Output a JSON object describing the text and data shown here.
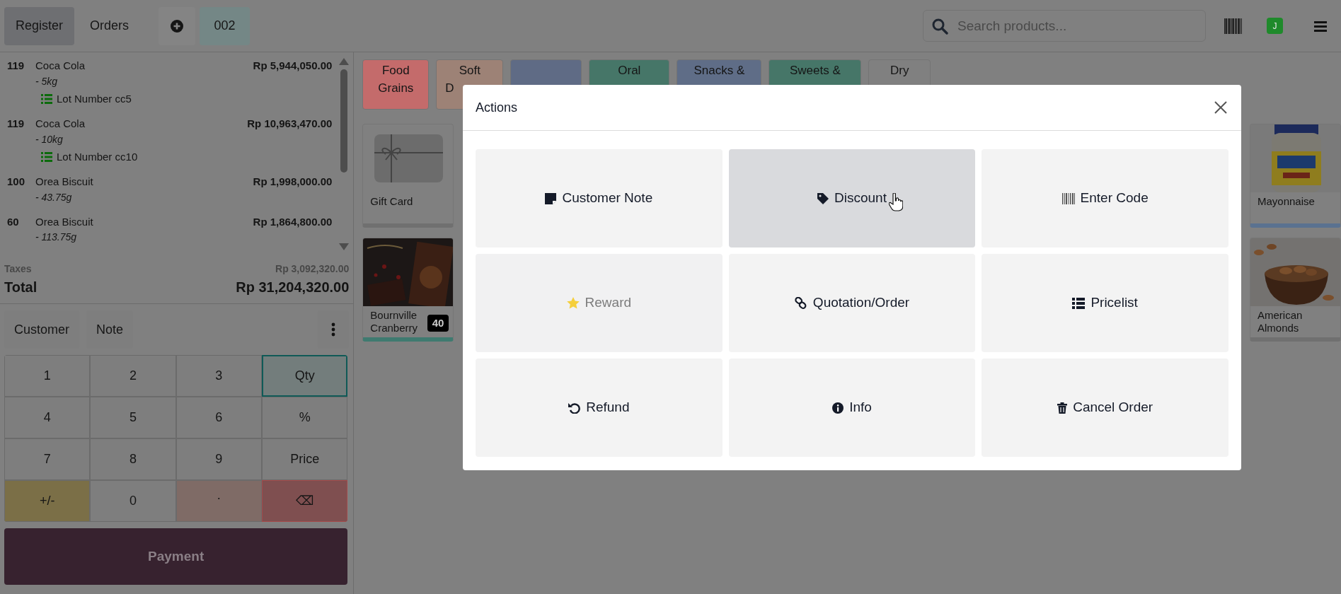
{
  "topbar": {
    "tabs": [
      {
        "label": "Register",
        "selected": true
      },
      {
        "label": "Orders",
        "selected": false
      }
    ],
    "order_tabs": [
      {
        "label": "002",
        "selected": true
      }
    ],
    "search": {
      "placeholder": "Search products..."
    },
    "user_initial": "J"
  },
  "order_lines": [
    {
      "qty": "119",
      "product": "Coca Cola",
      "variant": "- 5kg",
      "lot": "Lot Number cc5",
      "price": "Rp 5,944,050.00"
    },
    {
      "qty": "119",
      "product": "Coca Cola",
      "variant": "- 10kg",
      "lot": "Lot Number cc10",
      "price": "Rp 10,963,470.00"
    },
    {
      "qty": "100",
      "product": "Orea Biscuit",
      "variant": "- 43.75g",
      "price": "Rp 1,998,000.00"
    },
    {
      "qty": "60",
      "product": "Orea Biscuit",
      "variant": "- 113.75g",
      "price": "Rp 1,864,800.00"
    }
  ],
  "taxes": {
    "label": "Taxes",
    "amount": "Rp 3,092,320.00"
  },
  "total": {
    "label": "Total",
    "amount": "Rp 31,204,320.00"
  },
  "control_buttons": [
    "Customer",
    "Note"
  ],
  "numpad": [
    {
      "label": "1",
      "kind": "key"
    },
    {
      "label": "2",
      "kind": "key"
    },
    {
      "label": "3",
      "kind": "key"
    },
    {
      "label": "Qty",
      "kind": "mode",
      "selected": true
    },
    {
      "label": "4",
      "kind": "key"
    },
    {
      "label": "5",
      "kind": "key"
    },
    {
      "label": "6",
      "kind": "key"
    },
    {
      "label": "%",
      "kind": "mode",
      "selected": false
    },
    {
      "label": "7",
      "kind": "key"
    },
    {
      "label": "8",
      "kind": "key"
    },
    {
      "label": "9",
      "kind": "key"
    },
    {
      "label": "Price",
      "kind": "mode",
      "selected": false
    },
    {
      "label": "+/-",
      "kind": "sign"
    },
    {
      "label": "0",
      "kind": "key"
    },
    {
      "label": ".",
      "kind": "decimal"
    },
    {
      "label": "⌫",
      "kind": "backspace"
    }
  ],
  "payment_button": "Payment",
  "categories": [
    {
      "lines": [
        "Food",
        "Grains"
      ],
      "color": "#c46b6b"
    },
    {
      "lines": [
        "Soft",
        "D"
      ],
      "color": "#9d8276"
    },
    {
      "color": "#5f6b85"
    },
    {
      "lines": [
        "Oral"
      ],
      "color": "#467668"
    },
    {
      "lines": [
        "Snacks &"
      ],
      "color": "#5f6d87"
    },
    {
      "lines": [
        "Sweets &"
      ],
      "color": "#467668"
    },
    {
      "lines": [
        "Dry"
      ],
      "color": "#808080"
    }
  ],
  "products": [
    {
      "name": "Gift Card",
      "kind": "gift_card",
      "color": "#707070"
    },
    {
      "name": "Mayonnaise",
      "kind": "mayonnaise",
      "color": "#5a7290"
    },
    {
      "name": "Bournville Cranberry",
      "kind": "chocolate",
      "stock": "40",
      "color": "#3f7a70"
    },
    {
      "name": "American Almonds",
      "kind": "almonds",
      "color": "#707070"
    }
  ],
  "modal": {
    "title": "Actions",
    "actions": [
      {
        "label": "Customer Note",
        "disabled": false,
        "hovered": false
      },
      {
        "label": "Discount",
        "disabled": false,
        "hovered": true
      },
      {
        "label": "Enter Code",
        "disabled": false,
        "hovered": false
      },
      {
        "label": "Reward",
        "disabled": true,
        "hovered": false
      },
      {
        "label": "Quotation/Order",
        "disabled": false,
        "hovered": false
      },
      {
        "label": "Pricelist",
        "disabled": false,
        "hovered": false
      },
      {
        "label": "Refund",
        "disabled": false,
        "hovered": false
      },
      {
        "label": "Info",
        "disabled": false,
        "hovered": false
      },
      {
        "label": "Cancel Order",
        "disabled": false,
        "hovered": false
      }
    ]
  }
}
